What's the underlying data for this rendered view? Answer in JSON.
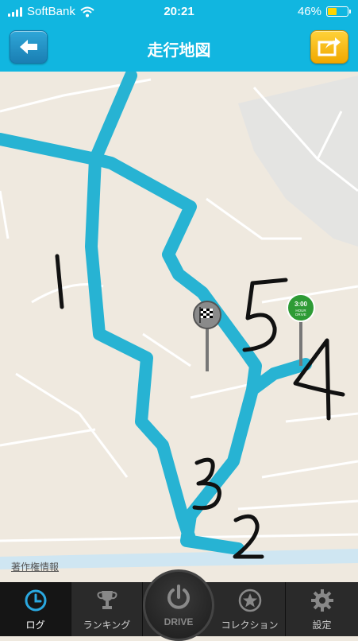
{
  "status_bar": {
    "carrier": "SoftBank",
    "time": "20:21",
    "battery": "46%",
    "battery_level": 0.46
  },
  "header": {
    "title": "走行地図"
  },
  "map": {
    "copyright": "著作権情報",
    "sign_text_top": "3:00",
    "sign_text_mid": "HOUR",
    "sign_text_bottom": "DRIVE",
    "handwritten": [
      "1",
      "2",
      "3",
      "4",
      "5"
    ]
  },
  "tabbar": {
    "tabs": [
      {
        "label": "ログ",
        "icon": "clock-icon"
      },
      {
        "label": "ランキング",
        "icon": "trophy-icon"
      },
      {
        "label": "DRIVE",
        "icon": "power-icon"
      },
      {
        "label": "コレクション",
        "icon": "star-icon"
      },
      {
        "label": "設定",
        "icon": "gear-icon"
      }
    ]
  },
  "colors": {
    "accent": "#11b6e0",
    "route": "#27b3d3",
    "tabbar": "#2a2a2a",
    "battery": "#ffd400"
  }
}
